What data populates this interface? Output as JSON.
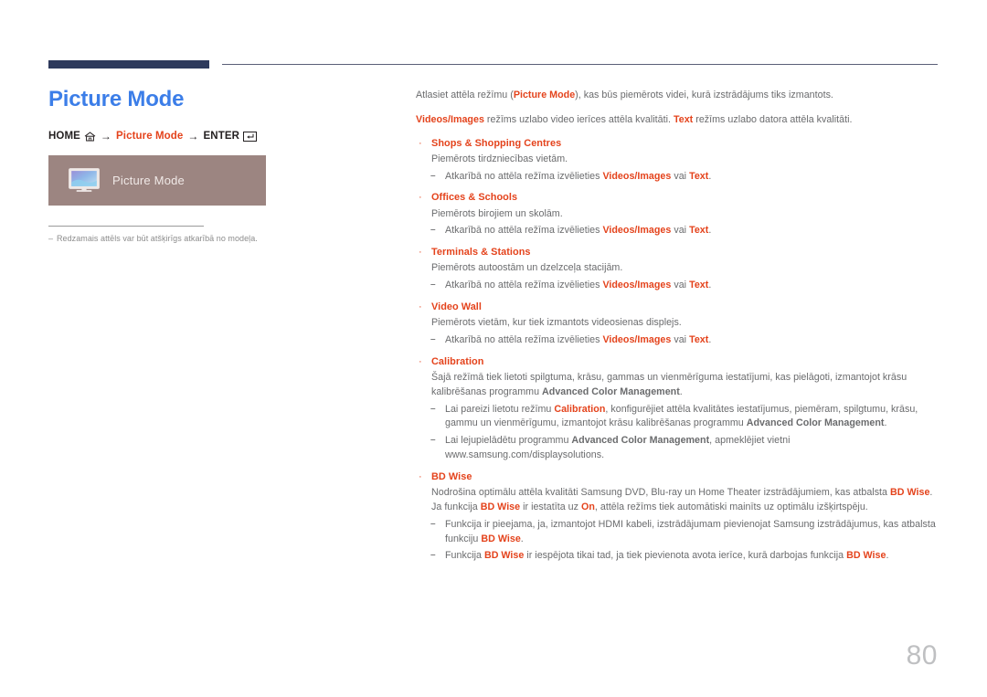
{
  "page": {
    "title": "Picture Mode",
    "page_number": "80",
    "accent_color": "#e4431c",
    "title_color": "#3c7ee8",
    "tab_color": "#2e3a5c",
    "osd_box_color": "#9c8581"
  },
  "breadcrumb": {
    "home_label": "HOME",
    "home_icon": "home-icon",
    "arrow": "→",
    "menu_label": "Picture Mode",
    "enter_label": "ENTER",
    "enter_icon": "enter-icon"
  },
  "osd": {
    "icon": "monitor-icon",
    "label": "Picture Mode",
    "note_dash": "–",
    "note": "Redzamais attēls var būt atšķirīgs atkarībā no modeļa."
  },
  "content": {
    "intro_1": {
      "part1": "Atlasiet attēla režīmu (",
      "kw1": "Picture Mode",
      "part2": "), kas būs piemērots videi, kurā izstrādājums tiks izmantots."
    },
    "intro_2": {
      "kw1": "Videos/Images",
      "part1": " režīms uzlabo video ierīces attēla kvalitāti. ",
      "kw2": "Text",
      "part2": " režīms uzlabo datora attēla kvalitāti."
    },
    "bullet_marker": "·",
    "dash_marker": "–",
    "sections": [
      {
        "title": "Shops & Shopping Centres",
        "desc": "Piemērots tirdzniecības vietām.",
        "subs": [
          {
            "p1": "Atkarībā no attēla režīma izvēlieties ",
            "k1": "Videos/Images",
            "p2": " vai ",
            "k2": "Text",
            "p3": "."
          }
        ]
      },
      {
        "title": "Offices & Schools",
        "desc": "Piemērots birojiem un skolām.",
        "subs": [
          {
            "p1": "Atkarībā no attēla režīma izvēlieties ",
            "k1": "Videos/Images",
            "p2": " vai ",
            "k2": "Text",
            "p3": "."
          }
        ]
      },
      {
        "title": "Terminals & Stations",
        "desc": "Piemērots autoostām un dzelzceļa stacijām.",
        "subs": [
          {
            "p1": "Atkarībā no attēla režīma izvēlieties ",
            "k1": "Videos/Images",
            "p2": " vai ",
            "k2": "Text",
            "p3": "."
          }
        ]
      },
      {
        "title": "Video Wall",
        "desc": "Piemērots vietām, kur tiek izmantots videosienas displejs.",
        "subs": [
          {
            "p1": "Atkarībā no attēla režīma izvēlieties ",
            "k1": "Videos/Images",
            "p2": " vai ",
            "k2": "Text",
            "p3": "."
          }
        ]
      },
      {
        "title": "Calibration",
        "desc_parts": {
          "p1": "Šajā režīmā tiek lietoti spilgtuma, krāsu, gammas un vienmērīguma iestatījumi, kas pielāgoti, izmantojot krāsu kalibrēšanas programmu ",
          "b1": "Advanced Color Management",
          "p2": "."
        },
        "subs": [
          {
            "p1": "Lai pareizi lietotu režīmu ",
            "k1": "Calibration",
            "p2": ", konfigurējiet attēla kvalitātes iestatījumus, piemēram, spilgtumu, krāsu, gammu un vienmērīgumu, izmantojot krāsu kalibrēšanas programmu ",
            "b2": "Advanced Color Management",
            "p3": "."
          },
          {
            "p1": "Lai lejupielādētu programmu ",
            "b1": "Advanced Color Management",
            "p2": ", apmeklējiet vietni www.samsung.com/displaysolutions."
          }
        ]
      },
      {
        "title": "BD Wise",
        "desc_parts": {
          "p1": "Nodrošina optimālu attēla kvalitāti Samsung DVD, Blu-ray un Home Theater izstrādājumiem, kas atbalsta ",
          "k1": "BD Wise",
          "p2": ". Ja funkcija ",
          "k2": "BD Wise",
          "p3": " ir iestatīta uz ",
          "k3": "On",
          "p4": ", attēla režīms tiek automātiski mainīts uz optimālu izšķirtspēju."
        },
        "subs": [
          {
            "p1": "Funkcija ir pieejama, ja, izmantojot HDMI kabeli, izstrādājumam pievienojat Samsung izstrādājumus, kas atbalsta funkciju ",
            "k1": "BD Wise",
            "p2": "."
          },
          {
            "p1": "Funkcija ",
            "k1": "BD Wise",
            "p2": " ir iespējota tikai tad, ja tiek pievienota avota ierīce, kurā darbojas funkcija ",
            "k2": "BD Wise",
            "p3": "."
          }
        ]
      }
    ]
  }
}
